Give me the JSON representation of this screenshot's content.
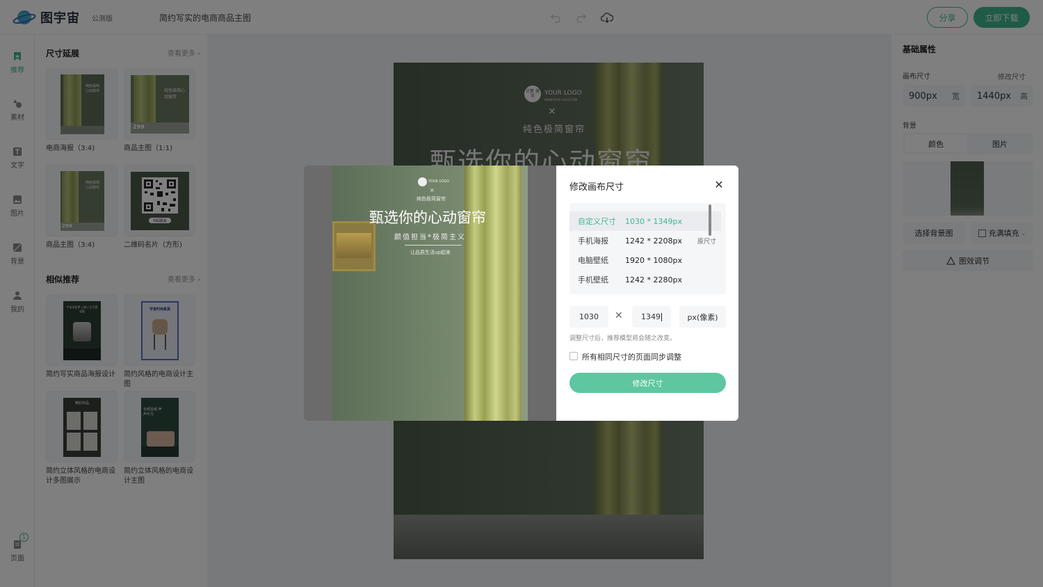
{
  "header": {
    "brand": "图宇宙",
    "beta": "公测版",
    "doc_title": "简约写实的电商商品主图",
    "undo_icon": "undo-icon",
    "redo_icon": "redo-icon",
    "cloud_icon": "cloud-save-icon",
    "share_label": "分享",
    "download_label": "立即下载",
    "accent": "#3fb68f"
  },
  "nav": {
    "items": [
      {
        "label": "推荐",
        "icon": "recommend-icon",
        "active": true
      },
      {
        "label": "素材",
        "icon": "shapes-icon"
      },
      {
        "label": "文字",
        "icon": "text-icon"
      },
      {
        "label": "图片",
        "icon": "image-icon"
      },
      {
        "label": "背景",
        "icon": "background-icon"
      },
      {
        "label": "我的",
        "icon": "user-icon"
      }
    ],
    "pages_label": "页面",
    "pages_count": "1"
  },
  "panel": {
    "size_section": {
      "title": "尺寸延展",
      "more": "查看更多",
      "cards": [
        {
          "label": "电商海报（3:4)",
          "thumb_text": "纯色极简心动窗帘"
        },
        {
          "label": "商品主图（1:1)",
          "thumb_text": "纯色极简心动窗帘",
          "price": "299"
        },
        {
          "label": "商品主图（3:4)",
          "thumb_text": "纯色极简心动窗帘",
          "price": "299"
        },
        {
          "label": "二维码名片（方形)",
          "thumb_text": "扫码联系"
        }
      ]
    },
    "similar_section": {
      "title": "相似推荐",
      "more": "查看更多",
      "cards": [
        {
          "label": "简约写实商品海报设计",
          "thumb_text": "宇宙电饭煲 让美入生活更温暖"
        },
        {
          "label": "简约风格的电商设计主图",
          "thumb_text": "宇宙时尚家具"
        },
        {
          "label": "简约立体风格的电商设计多图展示",
          "thumb_text": "精彩商品"
        },
        {
          "label": "简约立体风格的电商设计主图",
          "thumb_text": "全频音域 声声不凡"
        }
      ]
    }
  },
  "design": {
    "logo_badge": "计算 美学",
    "logo_text": "YOUR LOGO",
    "logo_url": "WWW.YOUR LOGO.COM",
    "cross": "×",
    "subtitle": "纯色极简窗帘",
    "headline": "甄选你的心动窗帘"
  },
  "right_panel": {
    "title": "基础属性",
    "canvas_size_label": "画布尺寸",
    "modify_size_label": "修改尺寸",
    "width_value": "900px",
    "width_unit": "宽",
    "height_value": "1440px",
    "height_unit": "高",
    "background_label": "背景",
    "tabs": [
      "颜色",
      "图片"
    ],
    "choose_bg_label": "选择背景图",
    "fill_label": "充满填充",
    "effect_label": "图效调节"
  },
  "preview": {
    "logo_text": "YOUR LOGO",
    "cross": "×",
    "subtitle": "纯色极简窗帘",
    "headline": "甄选你的心动窗帘",
    "tagline": "颜值担当*极简主义",
    "slogan": "让品质生活up起来"
  },
  "modal": {
    "title": "修改画布尺寸",
    "presets": [
      {
        "name": "自定义尺寸",
        "size": "1030 * 1349px",
        "selected": true,
        "original": ""
      },
      {
        "name": "手机海报",
        "size": "1242 * 2208px",
        "selected": false,
        "original": "原尺寸"
      },
      {
        "name": "电脑壁纸",
        "size": "1920 * 1080px",
        "selected": false,
        "original": ""
      },
      {
        "name": "手机壁纸",
        "size": "1242 * 2280px",
        "selected": false,
        "original": ""
      }
    ],
    "width_input": "1030",
    "times": "✕",
    "height_input": "1349",
    "unit": "px(像素)",
    "hint": "调整尺寸后，推荐模型将会随之改变。",
    "sync_label": "所有相同尺寸的页面同步调整",
    "sync_checked": false,
    "submit_label": "修改尺寸"
  }
}
